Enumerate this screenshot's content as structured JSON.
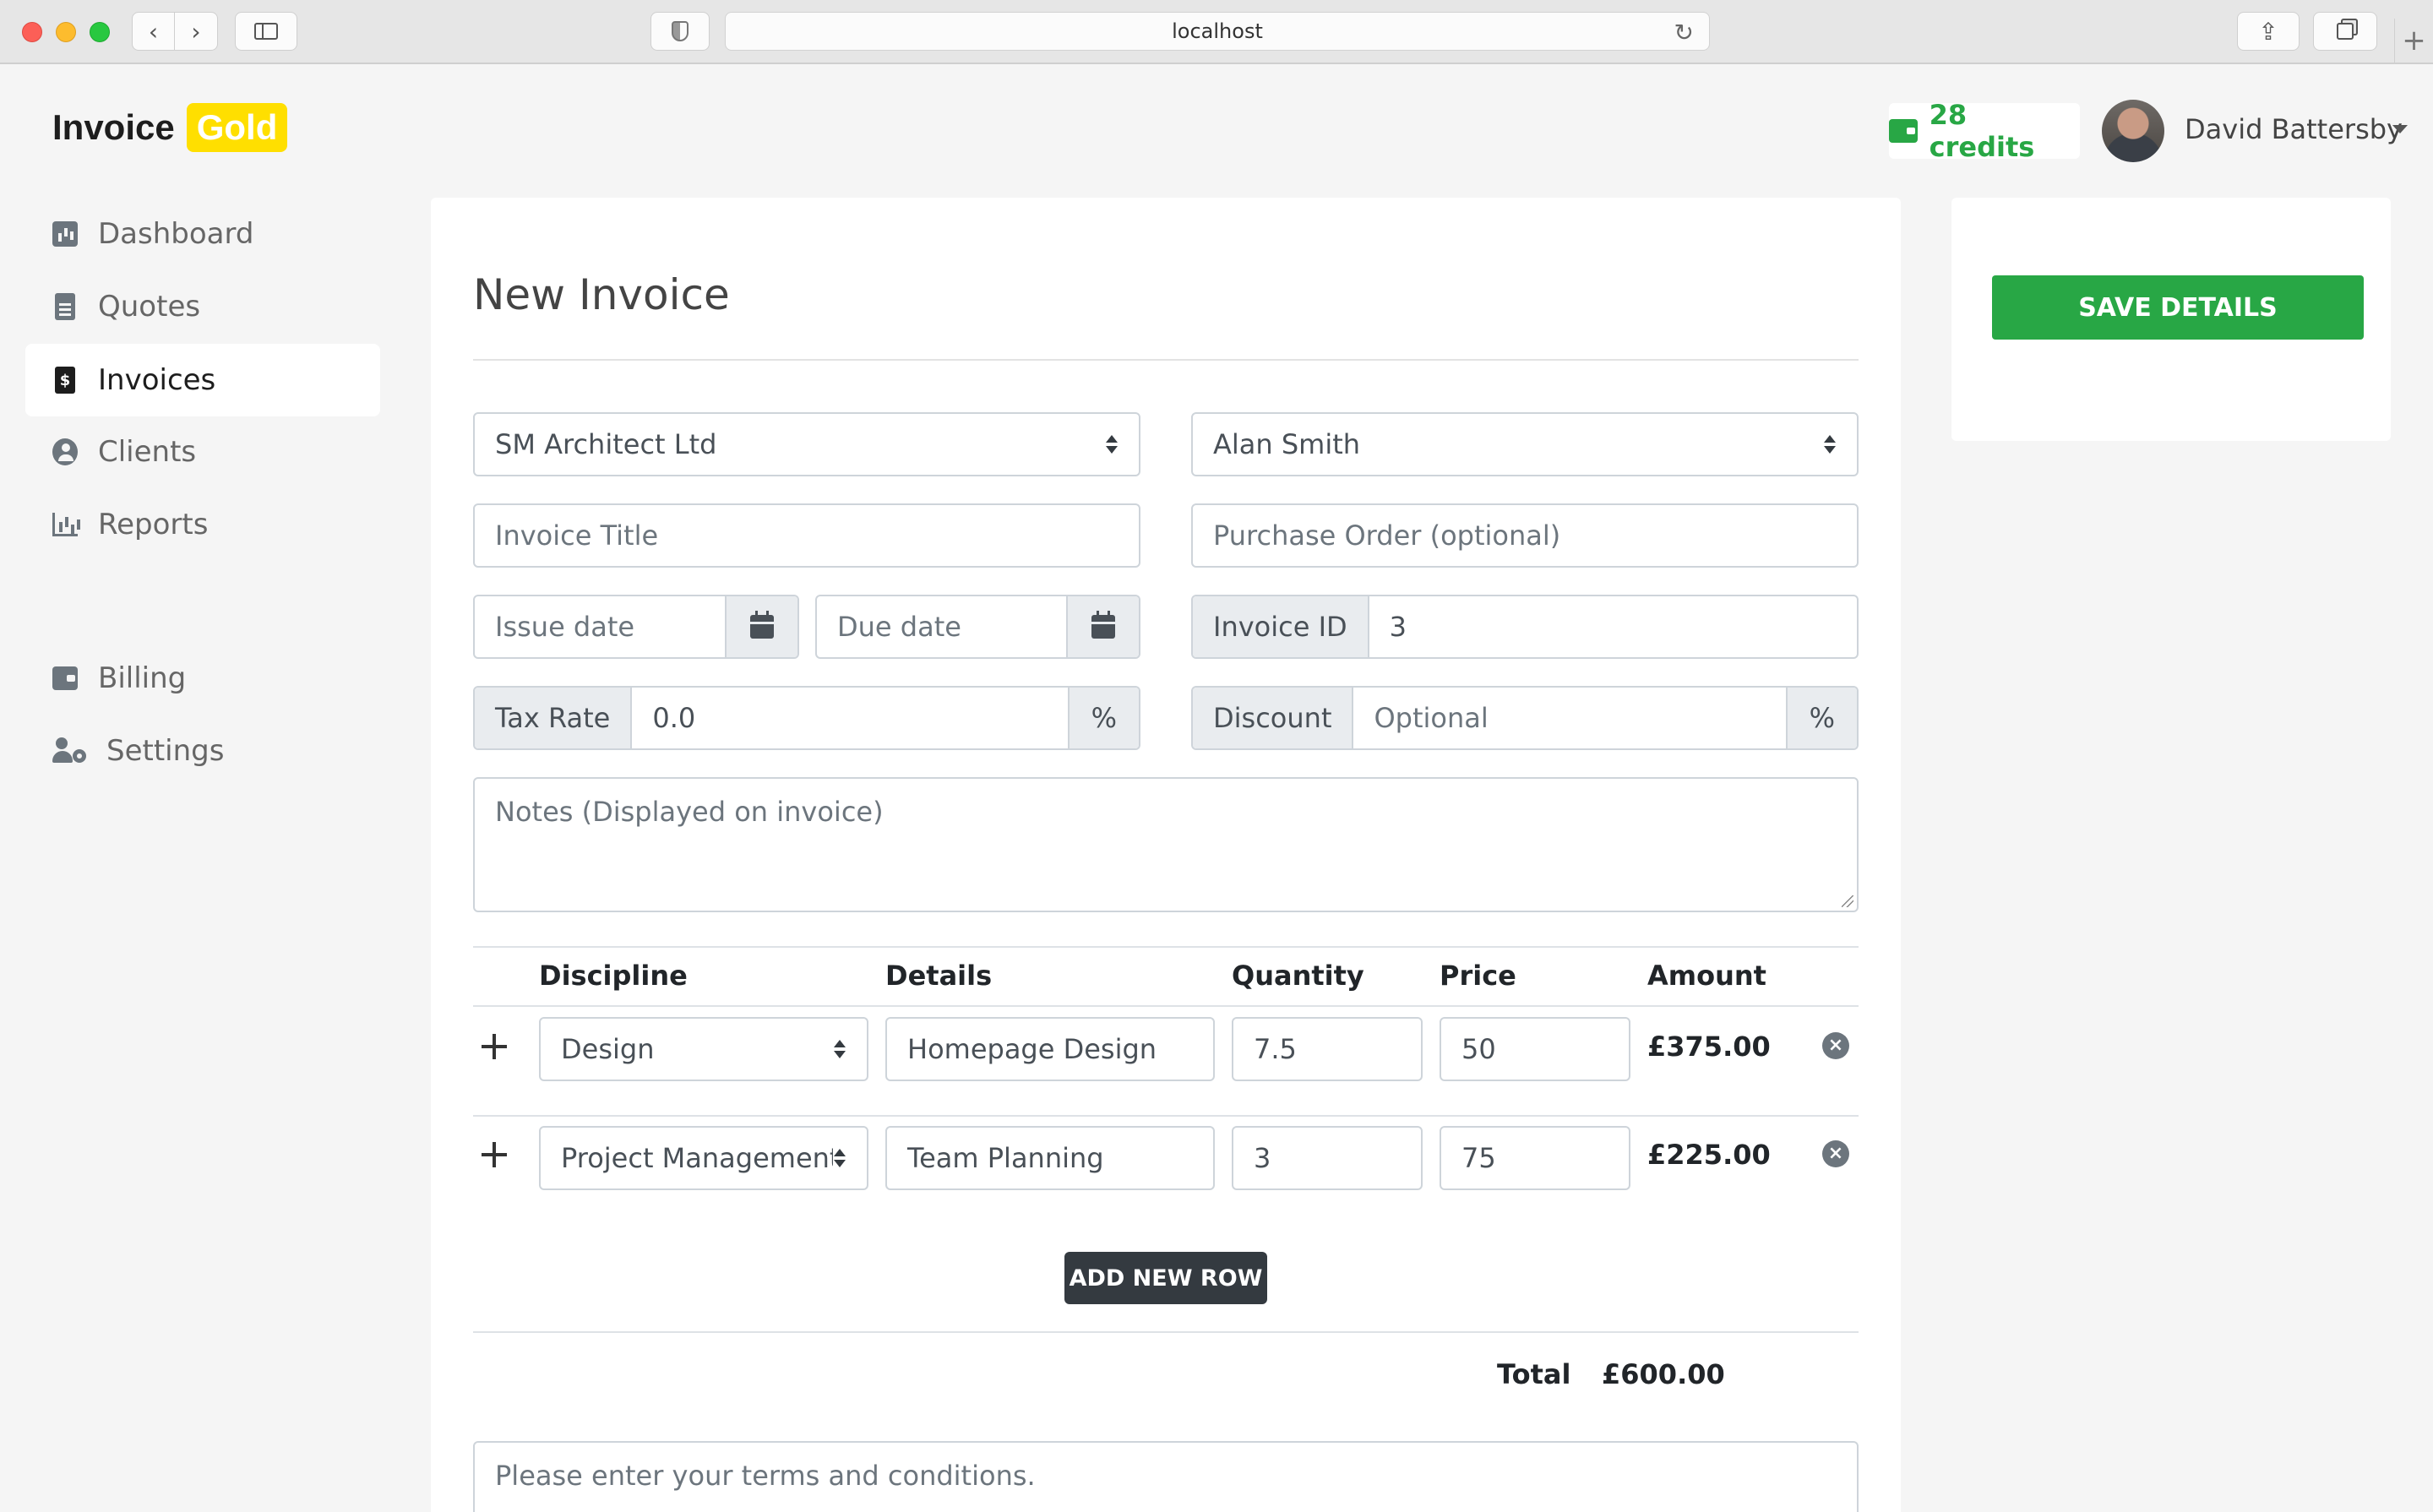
{
  "browser": {
    "url": "localhost"
  },
  "header": {
    "logo_word": "Invoice",
    "logo_badge": "Gold",
    "credits": "28 credits",
    "user_name": "David Battersby"
  },
  "sidebar": {
    "items": [
      {
        "label": "Dashboard",
        "icon": "chart-square-icon"
      },
      {
        "label": "Quotes",
        "icon": "document-icon"
      },
      {
        "label": "Invoices",
        "icon": "invoice-dollar-icon",
        "active": true
      },
      {
        "label": "Clients",
        "icon": "user-circle-icon"
      },
      {
        "label": "Reports",
        "icon": "bar-chart-icon"
      },
      {
        "label": "Billing",
        "icon": "wallet-icon"
      },
      {
        "label": "Settings",
        "icon": "user-cog-icon"
      }
    ]
  },
  "form": {
    "title": "New Invoice",
    "company_select": "SM Architect Ltd",
    "contact_select": "Alan Smith",
    "invoice_title_placeholder": "Invoice Title",
    "purchase_order_placeholder": "Purchase Order (optional)",
    "issue_date_placeholder": "Issue date",
    "due_date_placeholder": "Due date",
    "invoice_id_label": "Invoice ID",
    "invoice_id_value": "3",
    "tax_rate_label": "Tax Rate",
    "tax_rate_value": "0.0",
    "percent_symbol": "%",
    "discount_label": "Discount",
    "discount_placeholder": "Optional",
    "notes_placeholder": "Notes (Displayed on invoice)",
    "terms_placeholder": "Please enter your terms and conditions."
  },
  "items_table": {
    "headers": [
      "Discipline",
      "Details",
      "Quantity",
      "Price",
      "Amount"
    ],
    "rows": [
      {
        "discipline": "Design",
        "details": "Homepage Design",
        "quantity": "7.5",
        "price": "50",
        "amount": "£375.00"
      },
      {
        "discipline": "Project Management",
        "details": "Team Planning",
        "quantity": "3",
        "price": "75",
        "amount": "£225.00"
      }
    ],
    "add_row_label": "ADD NEW ROW",
    "total_label": "Total",
    "total_value": "£600.00"
  },
  "actions": {
    "save_label": "SAVE DETAILS"
  },
  "colors": {
    "brand_yellow": "#ffdf00",
    "success_green": "#28a745",
    "dark_button": "#343a40"
  }
}
